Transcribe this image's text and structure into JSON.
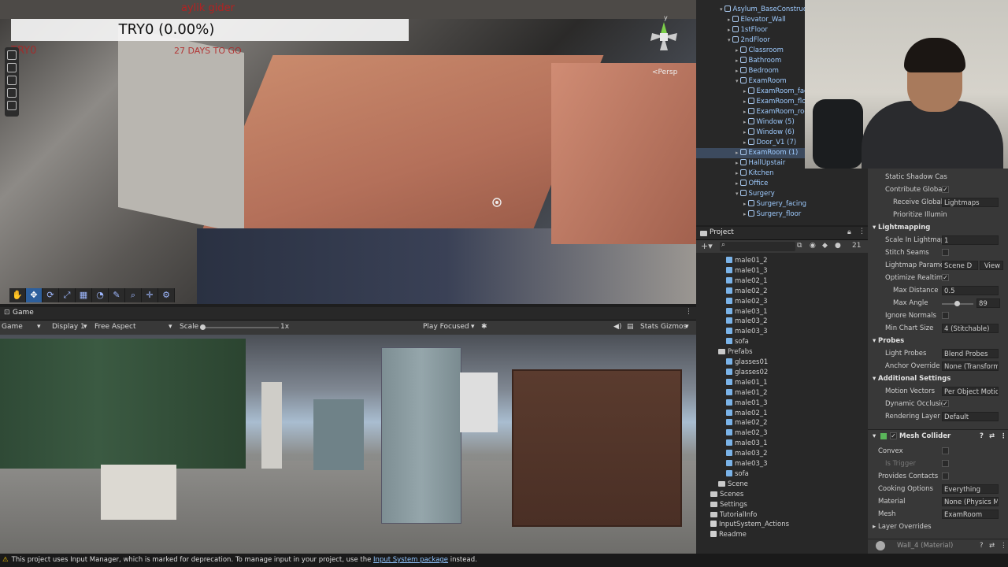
{
  "scene": {
    "hud_title": "TRY0 (0.00%)",
    "hud_top_label": "aylik gider",
    "hud_days": "27 DAYS TO GO",
    "hud_left_red": "TRY0",
    "persp_label": "<Persp",
    "axis_y": "y"
  },
  "game_view": {
    "tab": "Game",
    "mode": "Game",
    "display": "Display 1",
    "aspect": "Free Aspect",
    "scale_label": "Scale",
    "scale_value": "1x",
    "play_mode": "Play Focused",
    "stats": "Stats",
    "gizmos": "Gizmos"
  },
  "hierarchy": {
    "items": [
      {
        "label": "Asylum_BaseConstruct",
        "indent": 0,
        "expanded": true
      },
      {
        "label": "Elevator_Wall",
        "indent": 1
      },
      {
        "label": "1stFloor",
        "indent": 1
      },
      {
        "label": "2ndFloor",
        "indent": 1,
        "expanded": true
      },
      {
        "label": "Classroom",
        "indent": 2
      },
      {
        "label": "Bathroom",
        "indent": 2
      },
      {
        "label": "Bedroom",
        "indent": 2
      },
      {
        "label": "ExamRoom",
        "indent": 2,
        "expanded": true
      },
      {
        "label": "ExamRoom_facing",
        "indent": 3
      },
      {
        "label": "ExamRoom_floor",
        "indent": 3
      },
      {
        "label": "ExamRoom_roof",
        "indent": 3
      },
      {
        "label": "Window (5)",
        "indent": 3
      },
      {
        "label": "Window (6)",
        "indent": 3
      },
      {
        "label": "Door_V1 (7)",
        "indent": 3
      },
      {
        "label": "ExamRoom (1)",
        "indent": 2,
        "selected": true
      },
      {
        "label": "HallUpstair",
        "indent": 2
      },
      {
        "label": "Kitchen",
        "indent": 2
      },
      {
        "label": "Office",
        "indent": 2
      },
      {
        "label": "Surgery",
        "indent": 2,
        "expanded": true
      },
      {
        "label": "Surgery_facing",
        "indent": 3
      },
      {
        "label": "Surgery_floor",
        "indent": 3
      }
    ]
  },
  "project": {
    "tab": "Project",
    "search_placeholder": "",
    "count": "21",
    "items": [
      {
        "label": "male01_2",
        "type": "prefab",
        "indent": 2
      },
      {
        "label": "male01_3",
        "type": "prefab",
        "indent": 2
      },
      {
        "label": "male02_1",
        "type": "prefab",
        "indent": 2
      },
      {
        "label": "male02_2",
        "type": "prefab",
        "indent": 2
      },
      {
        "label": "male02_3",
        "type": "prefab",
        "indent": 2
      },
      {
        "label": "male03_1",
        "type": "prefab",
        "indent": 2
      },
      {
        "label": "male03_2",
        "type": "prefab",
        "indent": 2
      },
      {
        "label": "male03_3",
        "type": "prefab",
        "indent": 2
      },
      {
        "label": "sofa",
        "type": "prefab",
        "indent": 2
      },
      {
        "label": "Prefabs",
        "type": "folder",
        "indent": 1
      },
      {
        "label": "glasses01",
        "type": "prefab",
        "indent": 2
      },
      {
        "label": "glasses02",
        "type": "prefab",
        "indent": 2
      },
      {
        "label": "male01_1",
        "type": "prefab",
        "indent": 2
      },
      {
        "label": "male01_2",
        "type": "prefab",
        "indent": 2
      },
      {
        "label": "male01_3",
        "type": "prefab",
        "indent": 2
      },
      {
        "label": "male02_1",
        "type": "prefab",
        "indent": 2
      },
      {
        "label": "male02_2",
        "type": "prefab",
        "indent": 2
      },
      {
        "label": "male02_3",
        "type": "prefab",
        "indent": 2
      },
      {
        "label": "male03_1",
        "type": "prefab",
        "indent": 2
      },
      {
        "label": "male03_2",
        "type": "prefab",
        "indent": 2
      },
      {
        "label": "male03_3",
        "type": "prefab",
        "indent": 2
      },
      {
        "label": "sofa",
        "type": "prefab",
        "indent": 2
      },
      {
        "label": "Scene",
        "type": "folder",
        "indent": 1
      },
      {
        "label": "Scenes",
        "type": "folder",
        "indent": 0
      },
      {
        "label": "Settings",
        "type": "folder",
        "indent": 0
      },
      {
        "label": "TutorialInfo",
        "type": "folder",
        "indent": 0
      },
      {
        "label": "InputSystem_Actions",
        "type": "asset",
        "indent": 0
      },
      {
        "label": "Readme",
        "type": "asset",
        "indent": 0
      }
    ]
  },
  "inspector": {
    "static_shadow": "Static Shadow Cas",
    "contribute_gi": "Contribute Global",
    "receive_gi": "Receive Global",
    "receive_gi_value": "Lightmaps",
    "prioritize": "Prioritize Illumin",
    "lightmapping": "Lightmapping",
    "scale_in_lightmap": "Scale In Lightmap",
    "scale_in_lightmap_value": "1",
    "stitch_seams": "Stitch Seams",
    "lightmap_params": "Lightmap Paramet",
    "lightmap_params_value": "Scene D",
    "view_button": "View",
    "optimize_realtime": "Optimize Realtime",
    "max_distance": "Max Distance",
    "max_distance_value": "0.5",
    "max_angle": "Max Angle",
    "max_angle_value": "89",
    "ignore_normals": "Ignore Normals",
    "min_chart_size": "Min Chart Size",
    "min_chart_size_value": "4 (Stitchable)",
    "probes": "Probes",
    "light_probes": "Light Probes",
    "light_probes_value": "Blend Probes",
    "anchor_override": "Anchor Override",
    "anchor_override_value": "None (Transform)",
    "additional_settings": "Additional Settings",
    "motion_vectors": "Motion Vectors",
    "motion_vectors_value": "Per Object Motion",
    "dynamic_occlusion": "Dynamic Occlusion",
    "rendering_layer": "Rendering Layer M",
    "rendering_layer_value": "Default",
    "mesh_collider": "Mesh Collider",
    "convex": "Convex",
    "is_trigger": "Is Trigger",
    "provides_contacts": "Provides Contacts",
    "cooking_options": "Cooking Options",
    "cooking_options_value": "Everything",
    "material": "Material",
    "material_value": "None (Physics M",
    "mesh": "Mesh",
    "mesh_value": "ExamRoom",
    "layer_overrides": "Layer Overrides",
    "wall_material": "Wall_4 (Material)"
  },
  "status_bar": {
    "message": "This project uses Input Manager, which is marked for deprecation. To manage input in your project, use the",
    "link": "Input System package",
    "suffix": "instead."
  },
  "colors": {
    "accent": "#2d5f9c",
    "warning": "#f0c000",
    "hud_red": "#b22222",
    "link": "#8fc4ff"
  }
}
